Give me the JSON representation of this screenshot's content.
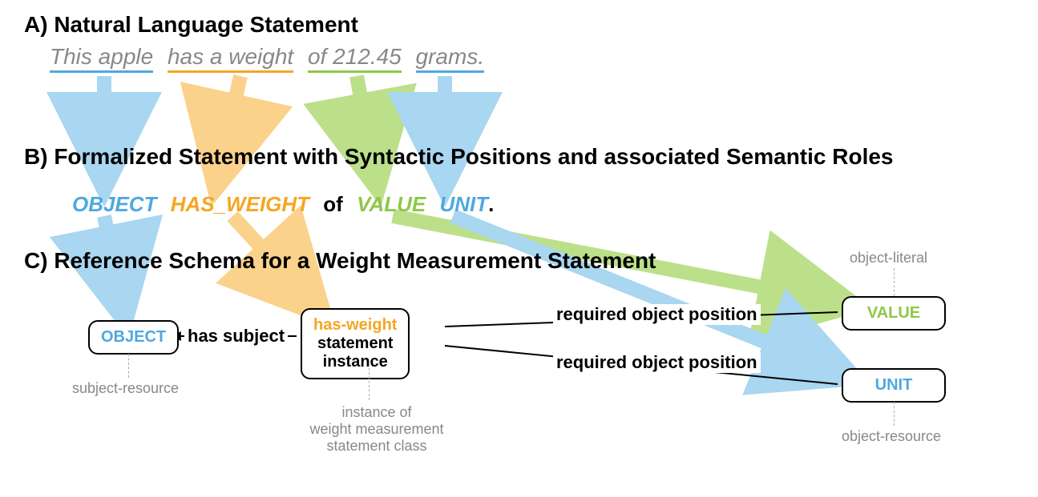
{
  "sectionA": {
    "title": "A) Natural Language Statement",
    "phrase1": "This apple",
    "phrase2": "has a weight",
    "phrase3": "of 212.45",
    "phrase4": "grams."
  },
  "sectionB": {
    "title": "B) Formalized Statement with Syntactic Positions and associated Semantic Roles",
    "tok_object": "OBJECT",
    "tok_hasweight": "HAS_WEIGHT",
    "tok_of": "of",
    "tok_value": "VALUE",
    "tok_unit": "UNIT",
    "tok_period": "."
  },
  "sectionC": {
    "title": "C) Reference Schema for a Weight Measurement Statement",
    "box_object": "OBJECT",
    "box_statement_line1": "has-weight",
    "box_statement_line2": "statement",
    "box_statement_line3": "instance",
    "box_value": "VALUE",
    "box_unit": "UNIT",
    "edge_has_subject": "has subject",
    "edge_req1": "required object position",
    "edge_req2": "required object position",
    "note_subject_resource": "subject-resource",
    "note_instance": "instance of\nweight measurement\nstatement class",
    "note_object_literal": "object-literal",
    "note_object_resource": "object-resource"
  },
  "colors": {
    "blue": "#4FA8E0",
    "orange": "#F5A623",
    "green": "#8FC749",
    "grey": "#888888"
  }
}
